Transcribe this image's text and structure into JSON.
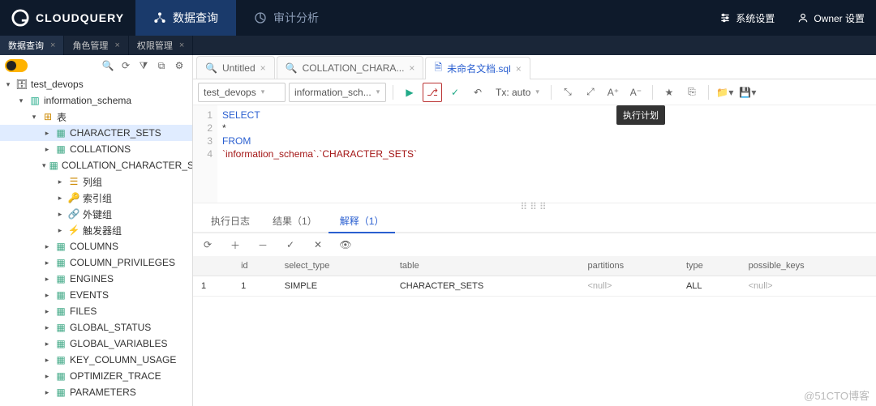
{
  "brand": "CLOUDQUERY",
  "top_tabs": [
    {
      "label": "数据查询",
      "active": true
    },
    {
      "label": "审计分析",
      "active": false
    }
  ],
  "sys_settings": "系统设置",
  "owner_settings": "Owner 设置",
  "sec_tabs": [
    {
      "label": "数据查询",
      "active": true
    },
    {
      "label": "角色管理",
      "active": false
    },
    {
      "label": "权限管理",
      "active": false
    }
  ],
  "tree": {
    "root": "test_devops",
    "schema": "information_schema",
    "tables_label": "表",
    "selected": "CHARACTER_SETS",
    "items": [
      "CHARACTER_SETS",
      "COLLATIONS",
      "COLLATION_CHARACTER_SET",
      "COLUMNS",
      "COLUMN_PRIVILEGES",
      "ENGINES",
      "EVENTS",
      "FILES",
      "GLOBAL_STATUS",
      "GLOBAL_VARIABLES",
      "KEY_COLUMN_USAGE",
      "OPTIMIZER_TRACE",
      "PARAMETERS"
    ],
    "sub": {
      "cols": "列组",
      "idx": "索引组",
      "fk": "外键组",
      "trg": "触发器组"
    }
  },
  "editor_tabs": [
    {
      "label": "Untitled",
      "active": false
    },
    {
      "label": "COLLATION_CHARA...",
      "active": false
    },
    {
      "label": "未命名文档.sql",
      "active": true
    }
  ],
  "selects": {
    "db": "test_devops",
    "schema": "information_sch..."
  },
  "tx_label": "Tx: auto",
  "tooltip": "执行计划",
  "sql_lines": [
    "SELECT",
    "  *",
    "FROM",
    "  `information_schema`.`CHARACTER_SETS`"
  ],
  "result_tabs": [
    {
      "label": "执行日志",
      "active": false
    },
    {
      "label": "结果（1）",
      "active": false
    },
    {
      "label": "解释（1）",
      "active": true
    }
  ],
  "table": {
    "cols": [
      "",
      "id",
      "select_type",
      "table",
      "partitions",
      "type",
      "possible_keys"
    ],
    "row": {
      "n": "1",
      "id": "1",
      "select_type": "SIMPLE",
      "table": "CHARACTER_SETS",
      "partitions": "<null>",
      "type": "ALL",
      "possible_keys": "<null>"
    }
  },
  "watermark": "@51CTO博客"
}
